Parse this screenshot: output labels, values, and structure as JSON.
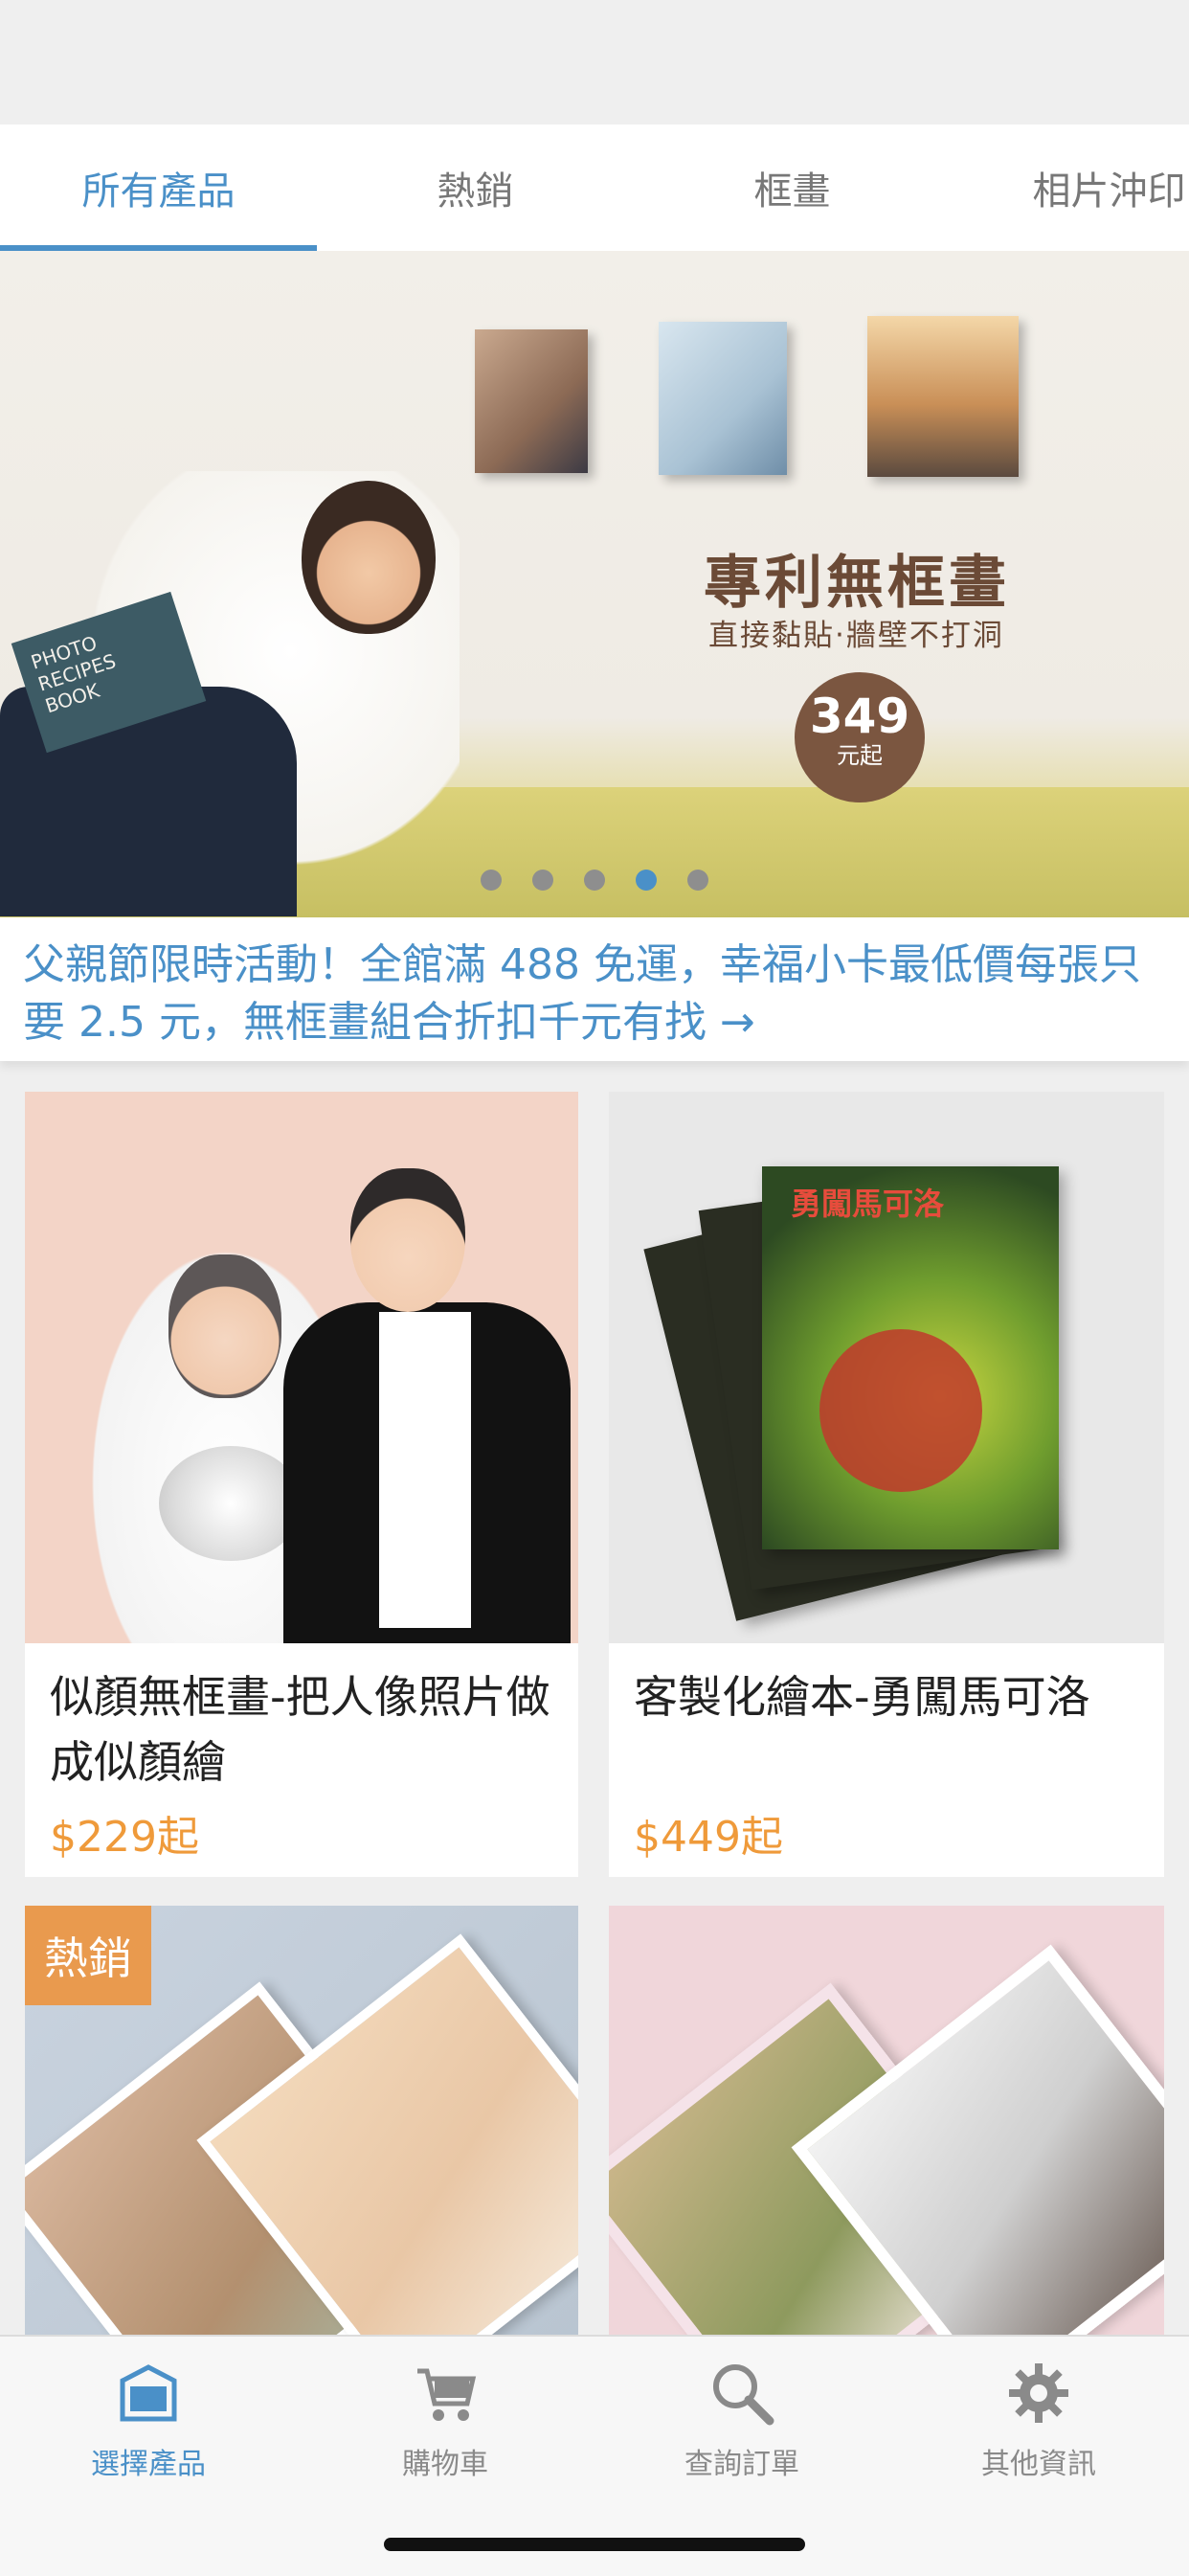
{
  "tabs": [
    {
      "label": "所有產品",
      "active": true
    },
    {
      "label": "熱銷",
      "active": false
    },
    {
      "label": "框畫",
      "active": false
    },
    {
      "label": "相片沖印",
      "active": false
    }
  ],
  "banner": {
    "title": "專利無框畫",
    "subtitle": "直接黏貼‧牆壁不打洞",
    "price": "349",
    "price_unit": "元起",
    "book_text": "PHOTO RECIPES BOOK",
    "carousel_total": 5,
    "carousel_active_index": 4
  },
  "promo": {
    "text": "父親節限時活動！全館滿 488 免運，幸福小卡最低價每張只要 2.5 元，無框畫組合折扣千元有找 →"
  },
  "products": [
    {
      "title": "似顏無框畫-把人像照片做成似顏繪",
      "price": "$229起"
    },
    {
      "title": "客製化繪本-勇闖馬可洛",
      "price": "$449起",
      "book_title": "勇闖馬可洛"
    },
    {
      "title": "",
      "price": "",
      "badge": "熱銷"
    },
    {
      "title": "",
      "price": ""
    }
  ],
  "tabbar": [
    {
      "label": "選擇產品",
      "icon": "store-icon",
      "active": true
    },
    {
      "label": "購物車",
      "icon": "cart-icon",
      "active": false
    },
    {
      "label": "查詢訂單",
      "icon": "search-icon",
      "active": false
    },
    {
      "label": "其他資訊",
      "icon": "gear-icon",
      "active": false
    }
  ],
  "colors": {
    "accent": "#4a90c8",
    "price": "#ef9a3a",
    "hot_badge": "#e99a4e",
    "banner_brown": "#7b5640"
  }
}
